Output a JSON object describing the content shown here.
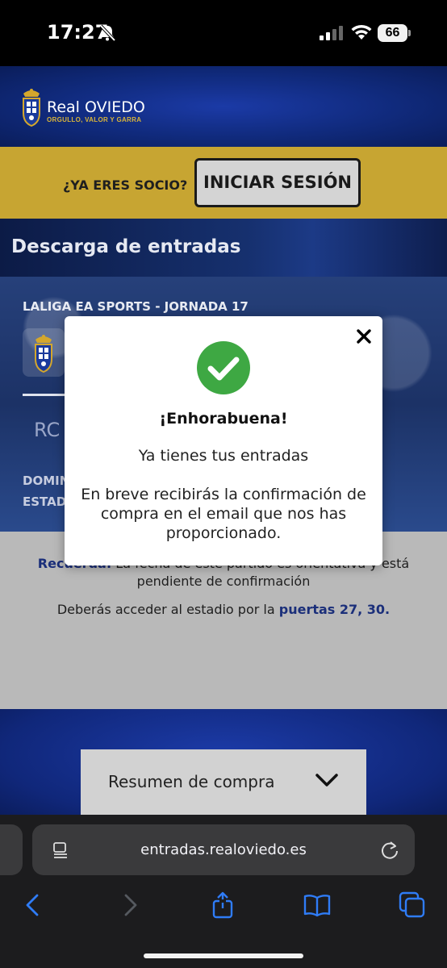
{
  "status_bar": {
    "time": "17:27",
    "battery": "66"
  },
  "header": {
    "brand_name": "Real OVIEDO",
    "brand_tagline": "ORGULLO, VALOR Y GARRA"
  },
  "socio_bar": {
    "question": "¿YA ERES SOCIO?",
    "login_label": "INICIAR SESIÓN"
  },
  "section": {
    "title": "Descarga de entradas"
  },
  "match": {
    "competition": "LALIGA EA SPORTS - JORNADA 17",
    "team_partial": "RC",
    "date_partial": "DOMIN",
    "stadium_partial": "ESTAD"
  },
  "info": {
    "reminder_label": "Recuerda:",
    "reminder_text": " La fecha de este partido es orientativa y está",
    "reminder_text_2": "pendiente de confirmación",
    "access_text": "Deberás acceder al estadio por la ",
    "access_gates": "puertas 27, 30."
  },
  "summary": {
    "label": "Resumen de compra"
  },
  "modal": {
    "title": "¡Enhorabuena!",
    "message": "Ya tienes tus entradas",
    "detail": "En breve recibirás la confirmación de compra en el email que nos has proporcionado."
  },
  "browser": {
    "url": "entradas.realoviedo.es"
  },
  "colors": {
    "brand_blue": "#10277a",
    "gold": "#c7a532",
    "success_green": "#3ea843"
  }
}
